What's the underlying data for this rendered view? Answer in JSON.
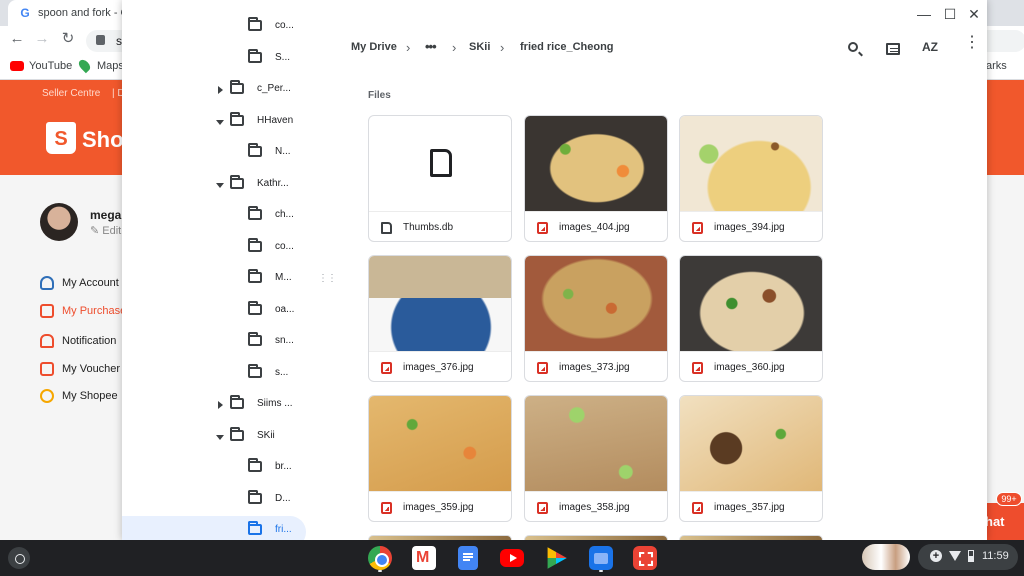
{
  "browser": {
    "tab_title": "spoon and fork - Goo",
    "url_partial": "sh",
    "bookmarks": [
      "YouTube",
      "Maps"
    ],
    "bookmarks_right": "arks"
  },
  "shopee": {
    "seller_centre": "Seller Centre",
    "separator_text": "| D",
    "logo_text": "Sho",
    "user_name": "megar",
    "edit_label": "Edit",
    "menu": [
      "My Account",
      "My Purchase",
      "Notification",
      "My Voucher",
      "My Shopee"
    ],
    "chat_label": "hat",
    "chat_badge": "99+",
    "brand_color": "#ee4d2d"
  },
  "files_app": {
    "window_controls": [
      "—",
      "☐",
      "✕"
    ],
    "tree": [
      {
        "label": "co...",
        "arrow": "none",
        "indent": 1
      },
      {
        "label": "S...",
        "arrow": "none",
        "indent": 1
      },
      {
        "label": "c_Per...",
        "arrow": "right",
        "indent": 0
      },
      {
        "label": "HHaven",
        "arrow": "down",
        "indent": 0
      },
      {
        "label": "N...",
        "arrow": "none",
        "indent": 1
      },
      {
        "label": "Kathr...",
        "arrow": "down",
        "indent": 0
      },
      {
        "label": "ch...",
        "arrow": "none",
        "indent": 1
      },
      {
        "label": "co...",
        "arrow": "none",
        "indent": 1
      },
      {
        "label": "M...",
        "arrow": "none",
        "indent": 1
      },
      {
        "label": "oa...",
        "arrow": "none",
        "indent": 1
      },
      {
        "label": "sn...",
        "arrow": "none",
        "indent": 1
      },
      {
        "label": "s...",
        "arrow": "none",
        "indent": 1
      },
      {
        "label": "Siims ...",
        "arrow": "right",
        "indent": 0
      },
      {
        "label": "SKii",
        "arrow": "down",
        "indent": 0
      },
      {
        "label": "br...",
        "arrow": "none",
        "indent": 1
      },
      {
        "label": "D...",
        "arrow": "none",
        "indent": 1
      },
      {
        "label": "fri...",
        "arrow": "none",
        "indent": 1,
        "selected": true
      }
    ],
    "breadcrumb": {
      "root": "My Drive",
      "more": "•••",
      "parent": "SKii",
      "current": "fried rice_Cheong",
      "separator": "›"
    },
    "toolbar": {
      "search_icon": "search-icon",
      "view_icon": "list-view-icon",
      "sort_label": "AZ",
      "menu_icon": "⋮"
    },
    "section_label": "Files",
    "files": [
      {
        "name": "Thumbs.db",
        "type": "doc"
      },
      {
        "name": "images_404.jpg",
        "type": "img",
        "thumb": "rice-a"
      },
      {
        "name": "images_394.jpg",
        "type": "img",
        "thumb": "rice-b"
      },
      {
        "name": "images_376.jpg",
        "type": "img",
        "thumb": "rice-c"
      },
      {
        "name": "images_373.jpg",
        "type": "img",
        "thumb": "rice-d"
      },
      {
        "name": "images_360.jpg",
        "type": "img",
        "thumb": "rice-e"
      },
      {
        "name": "images_359.jpg",
        "type": "img",
        "thumb": "rice-f"
      },
      {
        "name": "images_358.jpg",
        "type": "img",
        "thumb": "rice-g"
      },
      {
        "name": "images_357.jpg",
        "type": "img",
        "thumb": "rice-h"
      }
    ],
    "accent_color": "#1a73e8"
  },
  "shelf": {
    "apps": [
      "chrome-icon",
      "gmail-icon",
      "docs-icon",
      "youtube-icon",
      "play-store-icon",
      "files-icon",
      "screenshot-icon"
    ],
    "time": "11:59"
  }
}
